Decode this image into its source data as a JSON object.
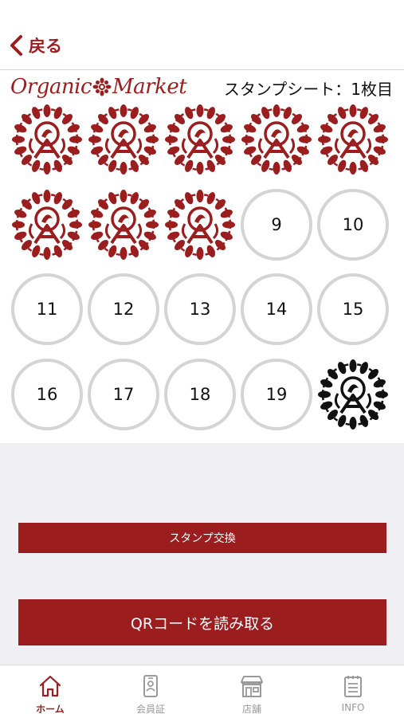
{
  "header": {
    "back_label": "戻る"
  },
  "brand": {
    "logo_left": "Organic",
    "logo_right": "Market"
  },
  "sheet": {
    "title": "スタンプシート：1枚目",
    "slots": [
      {
        "stamped": true,
        "stamp": "red"
      },
      {
        "stamped": true,
        "stamp": "red"
      },
      {
        "stamped": true,
        "stamp": "red"
      },
      {
        "stamped": true,
        "stamp": "red"
      },
      {
        "stamped": true,
        "stamp": "red"
      },
      {
        "stamped": true,
        "stamp": "red"
      },
      {
        "stamped": true,
        "stamp": "red"
      },
      {
        "stamped": true,
        "stamp": "red"
      },
      {
        "stamped": false,
        "label": "9"
      },
      {
        "stamped": false,
        "label": "10"
      },
      {
        "stamped": false,
        "label": "11"
      },
      {
        "stamped": false,
        "label": "12"
      },
      {
        "stamped": false,
        "label": "13"
      },
      {
        "stamped": false,
        "label": "14"
      },
      {
        "stamped": false,
        "label": "15"
      },
      {
        "stamped": false,
        "label": "16"
      },
      {
        "stamped": false,
        "label": "17"
      },
      {
        "stamped": false,
        "label": "18"
      },
      {
        "stamped": false,
        "label": "19"
      },
      {
        "stamped": false,
        "stamp": "black"
      }
    ]
  },
  "actions": {
    "exchange_label": "スタンプ交換",
    "qr_label": "QRコードを読み取る"
  },
  "tabbar": {
    "items": [
      {
        "label": "ホーム",
        "icon": "home-icon",
        "active": true
      },
      {
        "label": "会員証",
        "icon": "member-card-icon",
        "active": false
      },
      {
        "label": "店舗",
        "icon": "store-icon",
        "active": false
      },
      {
        "label": "INFO",
        "icon": "info-document-icon",
        "active": false
      }
    ]
  },
  "colors": {
    "accent": "#9b1d1d",
    "slot_border": "#d4d4d4",
    "stamp_black": "#111111",
    "background_gray": "#efeff4",
    "tab_inactive": "#9a9a9a"
  }
}
